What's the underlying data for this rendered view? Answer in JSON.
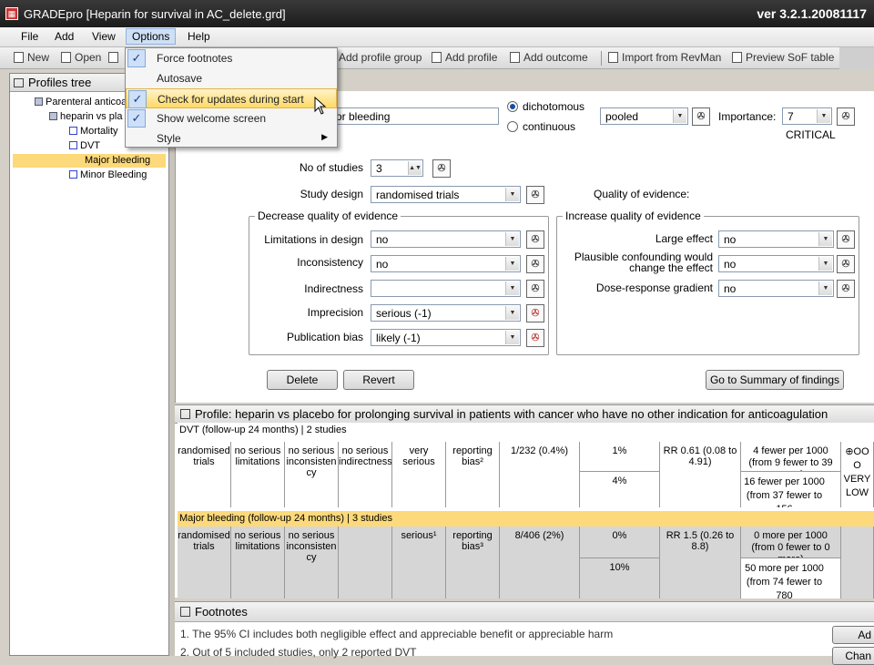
{
  "window": {
    "title": "GRADEpro [Heparin for survival in AC_delete.grd]",
    "version": "ver 3.2.1.20081117",
    "icon": "gradepro-app-icon"
  },
  "menubar": {
    "items": [
      "File",
      "Add",
      "View",
      "Options",
      "Help"
    ]
  },
  "toolbar": {
    "new": "New",
    "open": "Open",
    "add_profile_group": "Add profile group",
    "add_profile": "Add profile",
    "add_outcome": "Add outcome",
    "import_revman": "Import from RevMan",
    "preview_sof": "Preview SoF table"
  },
  "options_menu": {
    "items": [
      {
        "label": "Force footnotes",
        "checked": true
      },
      {
        "label": "Autosave",
        "checked": false
      },
      {
        "label": "Check for updates during start",
        "checked": true,
        "highlighted": true
      },
      {
        "label": "Show welcome screen",
        "checked": true
      },
      {
        "label": "Style",
        "submenu": true
      }
    ]
  },
  "profiles_tree": {
    "title": "Profiles tree",
    "nodes": [
      "Parenteral anticoa",
      "heparin vs pla",
      "Mortality",
      "DVT",
      "Major bleeding",
      "Minor Bleeding"
    ],
    "selected": "Major bleeding"
  },
  "outcome_form": {
    "outcome_name": "or bleeding",
    "type_dichotomous": "dichotomous",
    "type_continuous": "continuous",
    "pooling": "pooled",
    "importance_label": "Importance:",
    "importance_value": "7",
    "importance_text": "CRITICAL",
    "no_of_studies_label": "No of studies",
    "no_of_studies": "3",
    "study_design_label": "Study design",
    "study_design": "randomised trials",
    "quality_label": "Quality of evidence:",
    "decrease_group": "Decrease quality of evidence",
    "increase_group": "Increase quality of evidence",
    "limitations_label": "Limitations in design",
    "limitations": "no",
    "inconsistency_label": "Inconsistency",
    "inconsistency": "no",
    "indirectness_label": "Indirectness",
    "indirectness": "",
    "imprecision_label": "Imprecision",
    "imprecision": "serious (-1)",
    "publication_bias_label": "Publication bias",
    "publication_bias": "likely (-1)",
    "large_effect_label": "Large effect",
    "large_effect": "no",
    "confounding_label": "Plausible confounding would change the effect",
    "confounding": "no",
    "dose_response_label": "Dose-response gradient",
    "dose_response": "no",
    "delete_button": "Delete",
    "revert_button": "Revert",
    "summary_button": "Go to Summary of findings"
  },
  "profile": {
    "title": "Profile: heparin vs placebo for prolonging survival in patients with cancer who have no other indication for anticoagulation",
    "outcomes": [
      {
        "header": "DVT (follow-up 24 months) | 2 studies",
        "design": "randomised trials",
        "limitations": "no serious limitations",
        "inconsistency": "no serious inconsisten cy",
        "indirectness": "no serious indirectness",
        "imprecision": "very serious",
        "other": "reporting bias²",
        "events": "1/232  (0.4%)",
        "control_1": "1%",
        "control_2": "4%",
        "relative": "RR 0.61 (0.08 to 4.91)",
        "absolute_1": "4 fewer per 1000 (from 9 fewer to 39 more)",
        "absolute_2": "16 fewer per 1000 (from 37 fewer to 156",
        "quality": "⊕OO O VERY LOW"
      },
      {
        "header": "Major bleeding (follow-up 24 months) | 3 studies",
        "design": "randomised trials",
        "limitations": "no serious limitations",
        "inconsistency": "no serious inconsisten cy",
        "indirectness": "",
        "imprecision": "serious¹",
        "other": "reporting bias³",
        "events": "8/406  (2%)",
        "control_1": "0%",
        "control_2": "10%",
        "relative": "RR 1.5 (0.26 to 8.8)",
        "absolute_1": "0 more per 1000 (from 0 fewer to 0 more)",
        "absolute_2": "50 more per 1000 (from 74 fewer to 780",
        "quality": ""
      }
    ]
  },
  "footnotes": {
    "title": "Footnotes",
    "items": [
      "1. The 95% CI includes both negligible effect and appreciable benefit or appreciable harm",
      "2. Out of 5 included studies, only 2 reported DVT"
    ],
    "add_button": "Ad",
    "change_button": "Chan"
  },
  "colors": {
    "selection": "#fcd97a",
    "menu_highlight": "#ffd966",
    "row_header": "#fcd97a"
  }
}
